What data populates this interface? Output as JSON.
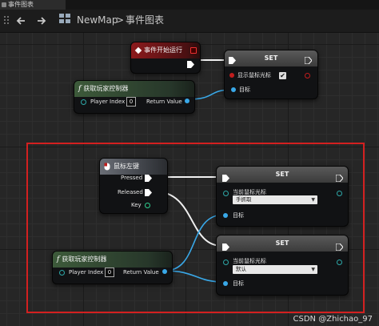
{
  "tab": {
    "title": "事件图表"
  },
  "toolbar": {
    "back_icon": "arrow-left",
    "forward_icon": "arrow-right"
  },
  "breadcrumb": {
    "root": "NewMap",
    "separator": ">",
    "current": "事件图表"
  },
  "colors": {
    "exec": "#ffffff",
    "object_pin": "#39a8e8",
    "bool_pin": "#c01d1d",
    "selection": "#d32020"
  },
  "nodes": {
    "begin_play": {
      "title": "事件开始运行"
    },
    "get_pc_1": {
      "title": "获取玩家控制器",
      "player_index_label": "Player Index",
      "player_index_value": "0",
      "return_label": "Return Value"
    },
    "set_1": {
      "title": "SET",
      "show_cursor_label": "显示鼠标光标",
      "target_label": "目标"
    },
    "mouse_left": {
      "title": "鼠标左键",
      "pressed_label": "Pressed",
      "released_label": "Released",
      "key_label": "Key"
    },
    "set_2": {
      "title": "SET",
      "cursor_label": "当前鼠标光标",
      "cursor_value": "手抓取",
      "target_label": "目标"
    },
    "set_3": {
      "title": "SET",
      "cursor_label": "当前鼠标光标",
      "cursor_value": "默认",
      "target_label": "目标"
    },
    "get_pc_2": {
      "title": "获取玩家控制器",
      "player_index_label": "Player Index",
      "player_index_value": "0",
      "return_label": "Return Value"
    }
  },
  "watermark": "CSDN @Zhichao_97"
}
